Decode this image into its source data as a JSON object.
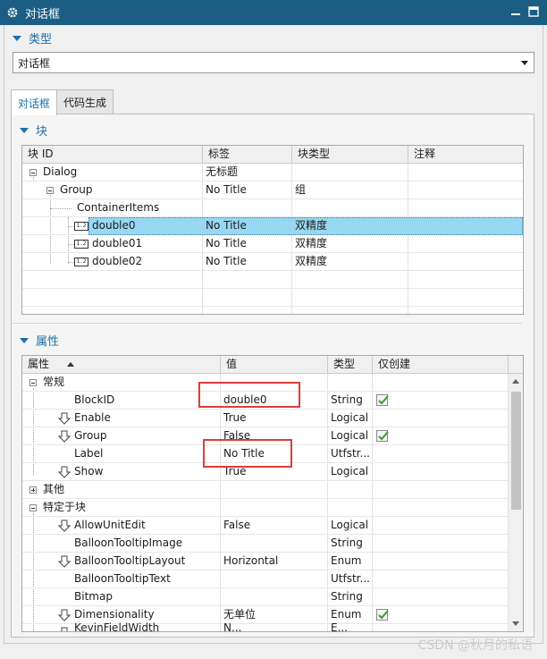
{
  "window": {
    "title": "对话框"
  },
  "type_section": {
    "header": "类型",
    "selected": "对话框"
  },
  "tabs": [
    {
      "label": "对话框"
    },
    {
      "label": "代码生成"
    }
  ],
  "blocks_section": {
    "header": "块",
    "columns": [
      "块 ID",
      "标签",
      "块类型",
      "注释"
    ],
    "rows": [
      {
        "id": "Dialog",
        "label": "无标题",
        "type": "",
        "note": ""
      },
      {
        "id": "Group",
        "label": "No Title",
        "type": "组",
        "note": ""
      },
      {
        "id": "ContainerItems",
        "label": "",
        "type": "",
        "note": ""
      },
      {
        "id": "double0",
        "label": "No Title",
        "type": "双精度",
        "note": "",
        "icon": "1.2"
      },
      {
        "id": "double01",
        "label": "No Title",
        "type": "双精度",
        "note": "",
        "icon": "1.2"
      },
      {
        "id": "double02",
        "label": "No Title",
        "type": "双精度",
        "note": "",
        "icon": "1.2"
      }
    ]
  },
  "props_section": {
    "header": "属性",
    "columns": [
      "属性",
      "值",
      "类型",
      "仅创建"
    ],
    "rows": [
      {
        "name": "常规",
        "value": "",
        "type": ""
      },
      {
        "name": "BlockID",
        "value": "double0",
        "type": "String"
      },
      {
        "name": "Enable",
        "value": "True",
        "type": "Logical"
      },
      {
        "name": "Group",
        "value": "False",
        "type": "Logical"
      },
      {
        "name": "Label",
        "value": "No Title",
        "type": "Utfstr..."
      },
      {
        "name": "Show",
        "value": "True",
        "type": "Logical"
      },
      {
        "name": "其他",
        "value": "",
        "type": ""
      },
      {
        "name": "特定于块",
        "value": "",
        "type": ""
      },
      {
        "name": "AllowUnitEdit",
        "value": "False",
        "type": "Logical"
      },
      {
        "name": "BalloonTooltipImage",
        "value": "",
        "type": "String"
      },
      {
        "name": "BalloonTooltipLayout",
        "value": "Horizontal",
        "type": "Enum"
      },
      {
        "name": "BalloonTooltipText",
        "value": "",
        "type": "Utfstr..."
      },
      {
        "name": "Bitmap",
        "value": "",
        "type": "String"
      },
      {
        "name": "Dimensionality",
        "value": "无单位",
        "type": "Enum"
      },
      {
        "name": "KeyinFieldWidth",
        "value": "N...",
        "type": "E..."
      }
    ]
  },
  "watermark": "CSDN @秋月的私语"
}
